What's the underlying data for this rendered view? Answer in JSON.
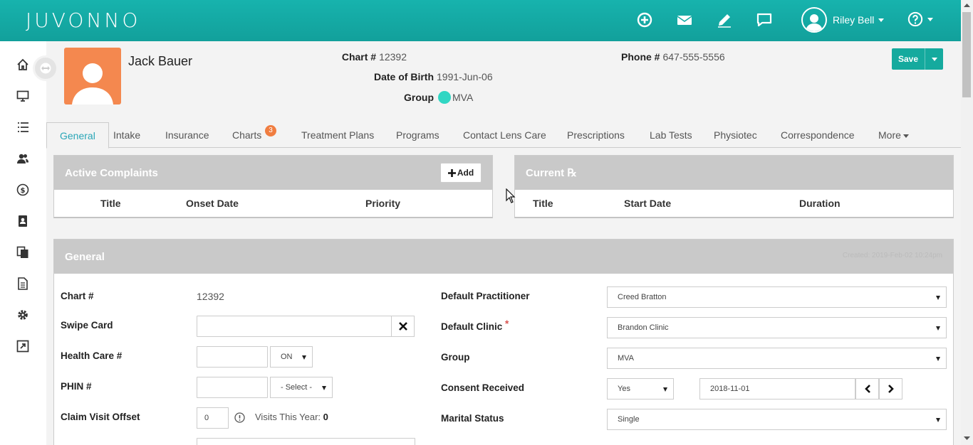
{
  "brand": {
    "logo": "JUVONNO",
    "accent": "#15aa9e"
  },
  "topbar": {
    "icons": [
      "add-circle-icon",
      "mail-icon",
      "edit-pencil-icon",
      "chat-icon"
    ],
    "user_name": "Riley Bell",
    "help_icon": "help-circle-icon"
  },
  "sidebar": {
    "items": [
      "home-icon",
      "monitor-icon",
      "list-icon",
      "users-icon",
      "dollar-icon",
      "contacts-book-icon",
      "files-icon",
      "document-icon",
      "gear-icon",
      "external-link-icon"
    ]
  },
  "patient": {
    "name": "Jack Bauer",
    "chart_label": "Chart #",
    "chart_value": "12392",
    "dob_label": "Date of Birth",
    "dob_value": "1991-Jun-06",
    "group_label": "Group",
    "group_value": "MVA",
    "group_color": "#30d6c3",
    "phone_label": "Phone #",
    "phone_value": "647-555-5556"
  },
  "actions": {
    "save_label": "Save"
  },
  "tabs": [
    {
      "label": "General",
      "active": true
    },
    {
      "label": "Intake"
    },
    {
      "label": "Insurance"
    },
    {
      "label": "Charts",
      "badge": "3"
    },
    {
      "label": "Treatment Plans"
    },
    {
      "label": "Programs"
    },
    {
      "label": "Contact Lens Care"
    },
    {
      "label": "Prescriptions"
    },
    {
      "label": "Lab Tests"
    },
    {
      "label": "Physiotec"
    },
    {
      "label": "Correspondence"
    },
    {
      "label": "More"
    }
  ],
  "complaints": {
    "title": "Active Complaints",
    "add_label": "Add",
    "columns": [
      "Title",
      "Onset Date",
      "Priority"
    ]
  },
  "current_rx": {
    "title": "Current ℞",
    "columns": [
      "Title",
      "Start Date",
      "Duration"
    ]
  },
  "general": {
    "title": "General",
    "created": "Created: 2019-Feb-02 10:24pm",
    "chart_label": "Chart #",
    "chart_value": "12392",
    "swipe_label": "Swipe Card",
    "swipe_value": "",
    "health_label": "Health Care #",
    "health_value": "",
    "province_value": "ON",
    "phin_label": "PHIN #",
    "phin_value": "",
    "phin_select": "- Select -",
    "claim_label": "Claim Visit Offset",
    "claim_value": "0",
    "visits_label": "Visits This Year:",
    "visits_value": "0",
    "practitioner_label": "Default Practitioner",
    "practitioner_value": "Creed Bratton",
    "clinic_label": "Default Clinic",
    "clinic_required": "*",
    "clinic_value": "Brandon Clinic",
    "group_label": "Group",
    "group_value": "MVA",
    "consent_label": "Consent Received",
    "consent_value": "Yes",
    "consent_date": "2018-11-01",
    "marital_label": "Marital Status",
    "marital_value": "Single"
  }
}
